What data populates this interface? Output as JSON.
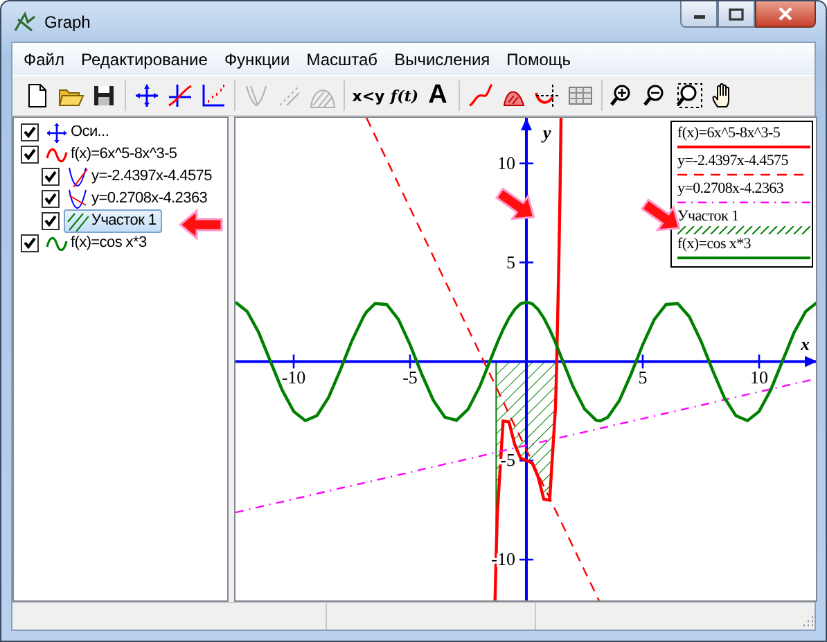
{
  "window": {
    "title": "Graph"
  },
  "menu": [
    "Файл",
    "Редактирование",
    "Функции",
    "Масштаб",
    "Вычисления",
    "Помощь"
  ],
  "toolbar": [
    [
      {
        "kind": "new",
        "disabled": false
      },
      {
        "kind": "open",
        "disabled": false
      },
      {
        "kind": "save",
        "disabled": false
      }
    ],
    [
      {
        "kind": "axes",
        "disabled": false
      },
      {
        "kind": "function",
        "disabled": false
      },
      {
        "kind": "point-series",
        "disabled": false
      }
    ],
    [
      {
        "kind": "tangent",
        "disabled": true
      },
      {
        "kind": "dashed-line",
        "disabled": true
      },
      {
        "kind": "shade",
        "disabled": true
      }
    ],
    [
      {
        "kind": "relation",
        "label": "x<y",
        "disabled": false
      },
      {
        "kind": "custom-function",
        "label": "f(t)",
        "disabled": false
      },
      {
        "kind": "label",
        "label": "A",
        "disabled": false
      }
    ],
    [
      {
        "kind": "curve",
        "disabled": false
      },
      {
        "kind": "area",
        "disabled": false
      },
      {
        "kind": "intersection",
        "disabled": false
      },
      {
        "kind": "table",
        "disabled": false
      }
    ],
    [
      {
        "kind": "zoom-in",
        "disabled": false
      },
      {
        "kind": "zoom-out",
        "disabled": false
      },
      {
        "kind": "zoom-box",
        "disabled": false
      },
      {
        "kind": "hand",
        "disabled": false
      }
    ]
  ],
  "tree": [
    {
      "kind": "axes",
      "label": "Оси...",
      "checked": true,
      "selected": false
    },
    {
      "kind": "function",
      "label": "f(x)=6x^5-8x^3-5",
      "color": "#ff0000",
      "checked": true,
      "selected": false,
      "children": [
        {
          "kind": "tangent",
          "label": "y=-2.4397x-4.4575",
          "checked": true,
          "selected": false
        },
        {
          "kind": "normal",
          "label": "y=0.2708x-4.2363",
          "checked": true,
          "selected": false
        },
        {
          "kind": "shade",
          "label": "Участок 1",
          "checked": true,
          "selected": true
        }
      ]
    },
    {
      "kind": "function",
      "label": "f(x)=cos x*3",
      "color": "#008000",
      "checked": true,
      "selected": false
    }
  ],
  "legend": [
    {
      "label": "f(x)=6x^5-8x^3-5",
      "kind": "solid-line",
      "color": "#ff0000"
    },
    {
      "label": "y=-2.4397x-4.4575",
      "kind": "dashed-line",
      "color": "#ff0000"
    },
    {
      "label": "y=0.2708x-4.2363",
      "kind": "dashdot-line",
      "color": "#ff00ff"
    },
    {
      "label": "Участок 1",
      "kind": "hatch",
      "color": "#008000"
    },
    {
      "label": "f(x)=cos x*3",
      "kind": "solid-line",
      "color": "#008000"
    }
  ],
  "chart_data": {
    "type": "line",
    "xlabel": "x",
    "ylabel": "y",
    "xlim": [
      -12.5,
      12.5
    ],
    "ylim": [
      -12.2,
      12.3
    ],
    "xticks": [
      -10,
      -5,
      5,
      10
    ],
    "yticks": [
      -10,
      -5,
      5,
      10
    ],
    "x": [
      -12.5,
      -12,
      -11.5,
      -11,
      -10.5,
      -10,
      -9.5,
      -9,
      -8.5,
      -8,
      -7.5,
      -7,
      -6.87,
      -6.5,
      -6,
      -5.5,
      -5,
      -4.5,
      -4,
      -3.5,
      -3,
      -2.5,
      -2,
      -1.5,
      -1.35,
      -1.3,
      -1.25,
      -1,
      -0.75,
      -0.5,
      -0.25,
      0,
      0.25,
      0.5,
      0.75,
      1,
      1.25,
      1.3,
      1.4,
      1.45,
      1.49,
      1.5,
      2,
      2.5,
      3,
      3.17,
      3.5,
      4,
      4.5,
      5,
      5.5,
      6,
      6.5,
      7,
      7.5,
      8,
      8.5,
      9,
      9.5,
      10,
      10.5,
      11,
      11.5,
      12,
      12.5
    ],
    "series": [
      {
        "color": "#ff0000",
        "line_style": "solid",
        "values": [
          null,
          null,
          null,
          null,
          null,
          null,
          null,
          null,
          null,
          null,
          null,
          null,
          null,
          null,
          null,
          null,
          null,
          null,
          null,
          null,
          null,
          null,
          null,
          null,
          -12.2,
          -9.7,
          -7.69,
          -3,
          -3.05,
          -4.19,
          -4.88,
          -5,
          -5.12,
          -5.81,
          -6.95,
          -7,
          -2.31,
          -0.3,
          5.32,
          9.07,
          12.3,
          null,
          null,
          null,
          null,
          null,
          null,
          null,
          null,
          null,
          null,
          null,
          null,
          null,
          null,
          null,
          null,
          null,
          null,
          null,
          null,
          null,
          null,
          null,
          null
        ]
      },
      {
        "color": "#ff0000",
        "line_style": "dashed",
        "values": [
          null,
          null,
          null,
          null,
          null,
          null,
          null,
          null,
          null,
          null,
          null,
          null,
          12.3,
          11.4,
          10.18,
          8.96,
          7.74,
          6.52,
          5.3,
          4.08,
          2.86,
          1.64,
          0.42,
          -0.8,
          -1.16,
          -1.29,
          -1.41,
          -2.02,
          -2.63,
          -3.24,
          -3.85,
          -4.46,
          -5.07,
          -5.68,
          -6.29,
          -6.9,
          -7.51,
          -7.63,
          -7.87,
          -7.99,
          -8.09,
          -8.12,
          -9.34,
          -10.56,
          -11.78,
          -12.19,
          null,
          null,
          null,
          null,
          null,
          null,
          null,
          null,
          null,
          null,
          null,
          null,
          null,
          null,
          null,
          null,
          null,
          null,
          null
        ]
      },
      {
        "color": "#ff00ff",
        "line_style": "dashdot",
        "values": [
          -7.62,
          -7.49,
          -7.35,
          -7.21,
          -7.08,
          -6.94,
          -6.81,
          -6.67,
          -6.54,
          -6.4,
          -6.27,
          -6.13,
          -6.1,
          -6,
          -5.86,
          -5.73,
          -5.59,
          -5.45,
          -5.32,
          -5.18,
          -5.05,
          -4.91,
          -4.78,
          -4.64,
          -4.6,
          -4.59,
          -4.57,
          -4.51,
          -4.44,
          -4.37,
          -4.3,
          -4.24,
          -4.17,
          -4.1,
          -4.03,
          -3.97,
          -3.9,
          -3.88,
          -3.86,
          -3.84,
          -3.83,
          -3.83,
          -3.69,
          -3.56,
          -3.42,
          -3.38,
          -3.29,
          -3.15,
          -3.02,
          -2.88,
          -2.75,
          -2.61,
          -2.48,
          -2.34,
          -2.21,
          -2.07,
          -1.93,
          -1.8,
          -1.66,
          -1.53,
          -1.39,
          -1.26,
          -1.12,
          -0.99,
          -0.85
        ]
      },
      {
        "color": "#008000",
        "line_style": "solid",
        "values": [
          2.99,
          2.53,
          1.46,
          0.01,
          -1.43,
          -2.52,
          -2.99,
          -2.73,
          -1.81,
          -0.44,
          1.04,
          2.26,
          2.5,
          2.93,
          2.88,
          2.13,
          0.85,
          -0.63,
          -1.96,
          -2.81,
          -2.97,
          -2.4,
          -1.25,
          0.21,
          0.66,
          0.8,
          0.95,
          1.62,
          2.19,
          2.63,
          2.91,
          3,
          2.91,
          2.63,
          2.19,
          1.62,
          0.95,
          0.8,
          0.51,
          0.36,
          0.24,
          0.21,
          -1.25,
          -2.4,
          -2.97,
          -3,
          -2.81,
          -1.96,
          -0.63,
          0.85,
          2.13,
          2.88,
          2.93,
          2.26,
          1.04,
          -0.44,
          -1.81,
          -2.73,
          -2.99,
          -2.52,
          -1.43,
          0.01,
          1.46,
          2.53,
          2.99
        ]
      },
      {
        "type": "area",
        "color": "#008000",
        "values": [
          null,
          null,
          null,
          null,
          null,
          null,
          null,
          null,
          null,
          null,
          null,
          null,
          null,
          null,
          null,
          null,
          null,
          null,
          null,
          null,
          null,
          null,
          null,
          null,
          null,
          -9.7,
          -7.69,
          -3,
          -3.05,
          -4.19,
          -4.88,
          -5,
          -5.12,
          -5.81,
          -6.95,
          -7,
          -2.31,
          -0.3,
          null,
          null,
          null,
          null,
          null,
          null,
          null,
          null,
          null,
          null,
          null,
          null,
          null,
          null,
          null,
          null,
          null,
          null,
          null,
          null,
          null,
          null,
          null,
          null,
          null,
          null,
          null
        ]
      }
    ]
  }
}
